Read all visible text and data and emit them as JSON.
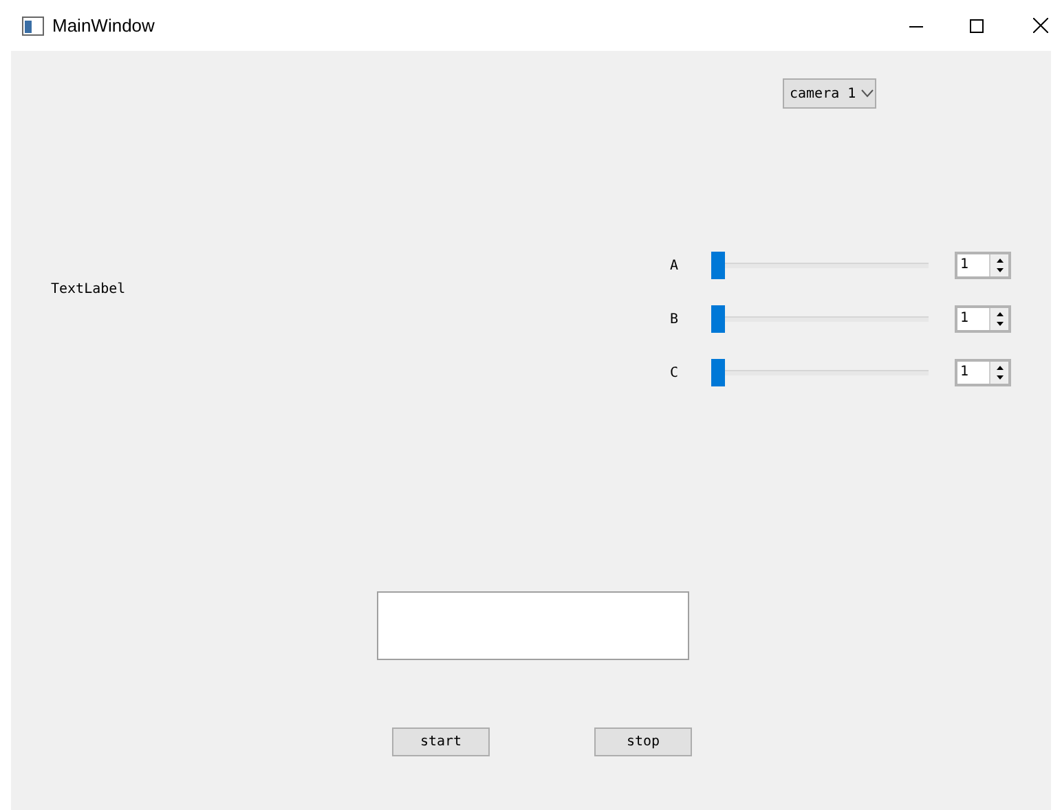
{
  "window": {
    "title": "MainWindow"
  },
  "camera_select": {
    "value": "camera 1"
  },
  "text_label": "TextLabel",
  "sliders": [
    {
      "label": "A",
      "level": 0,
      "value": "1"
    },
    {
      "label": "B",
      "level": 0,
      "value": "1"
    },
    {
      "label": "C",
      "level": 0,
      "value": "1"
    }
  ],
  "buttons": [
    "start",
    "stop"
  ]
}
